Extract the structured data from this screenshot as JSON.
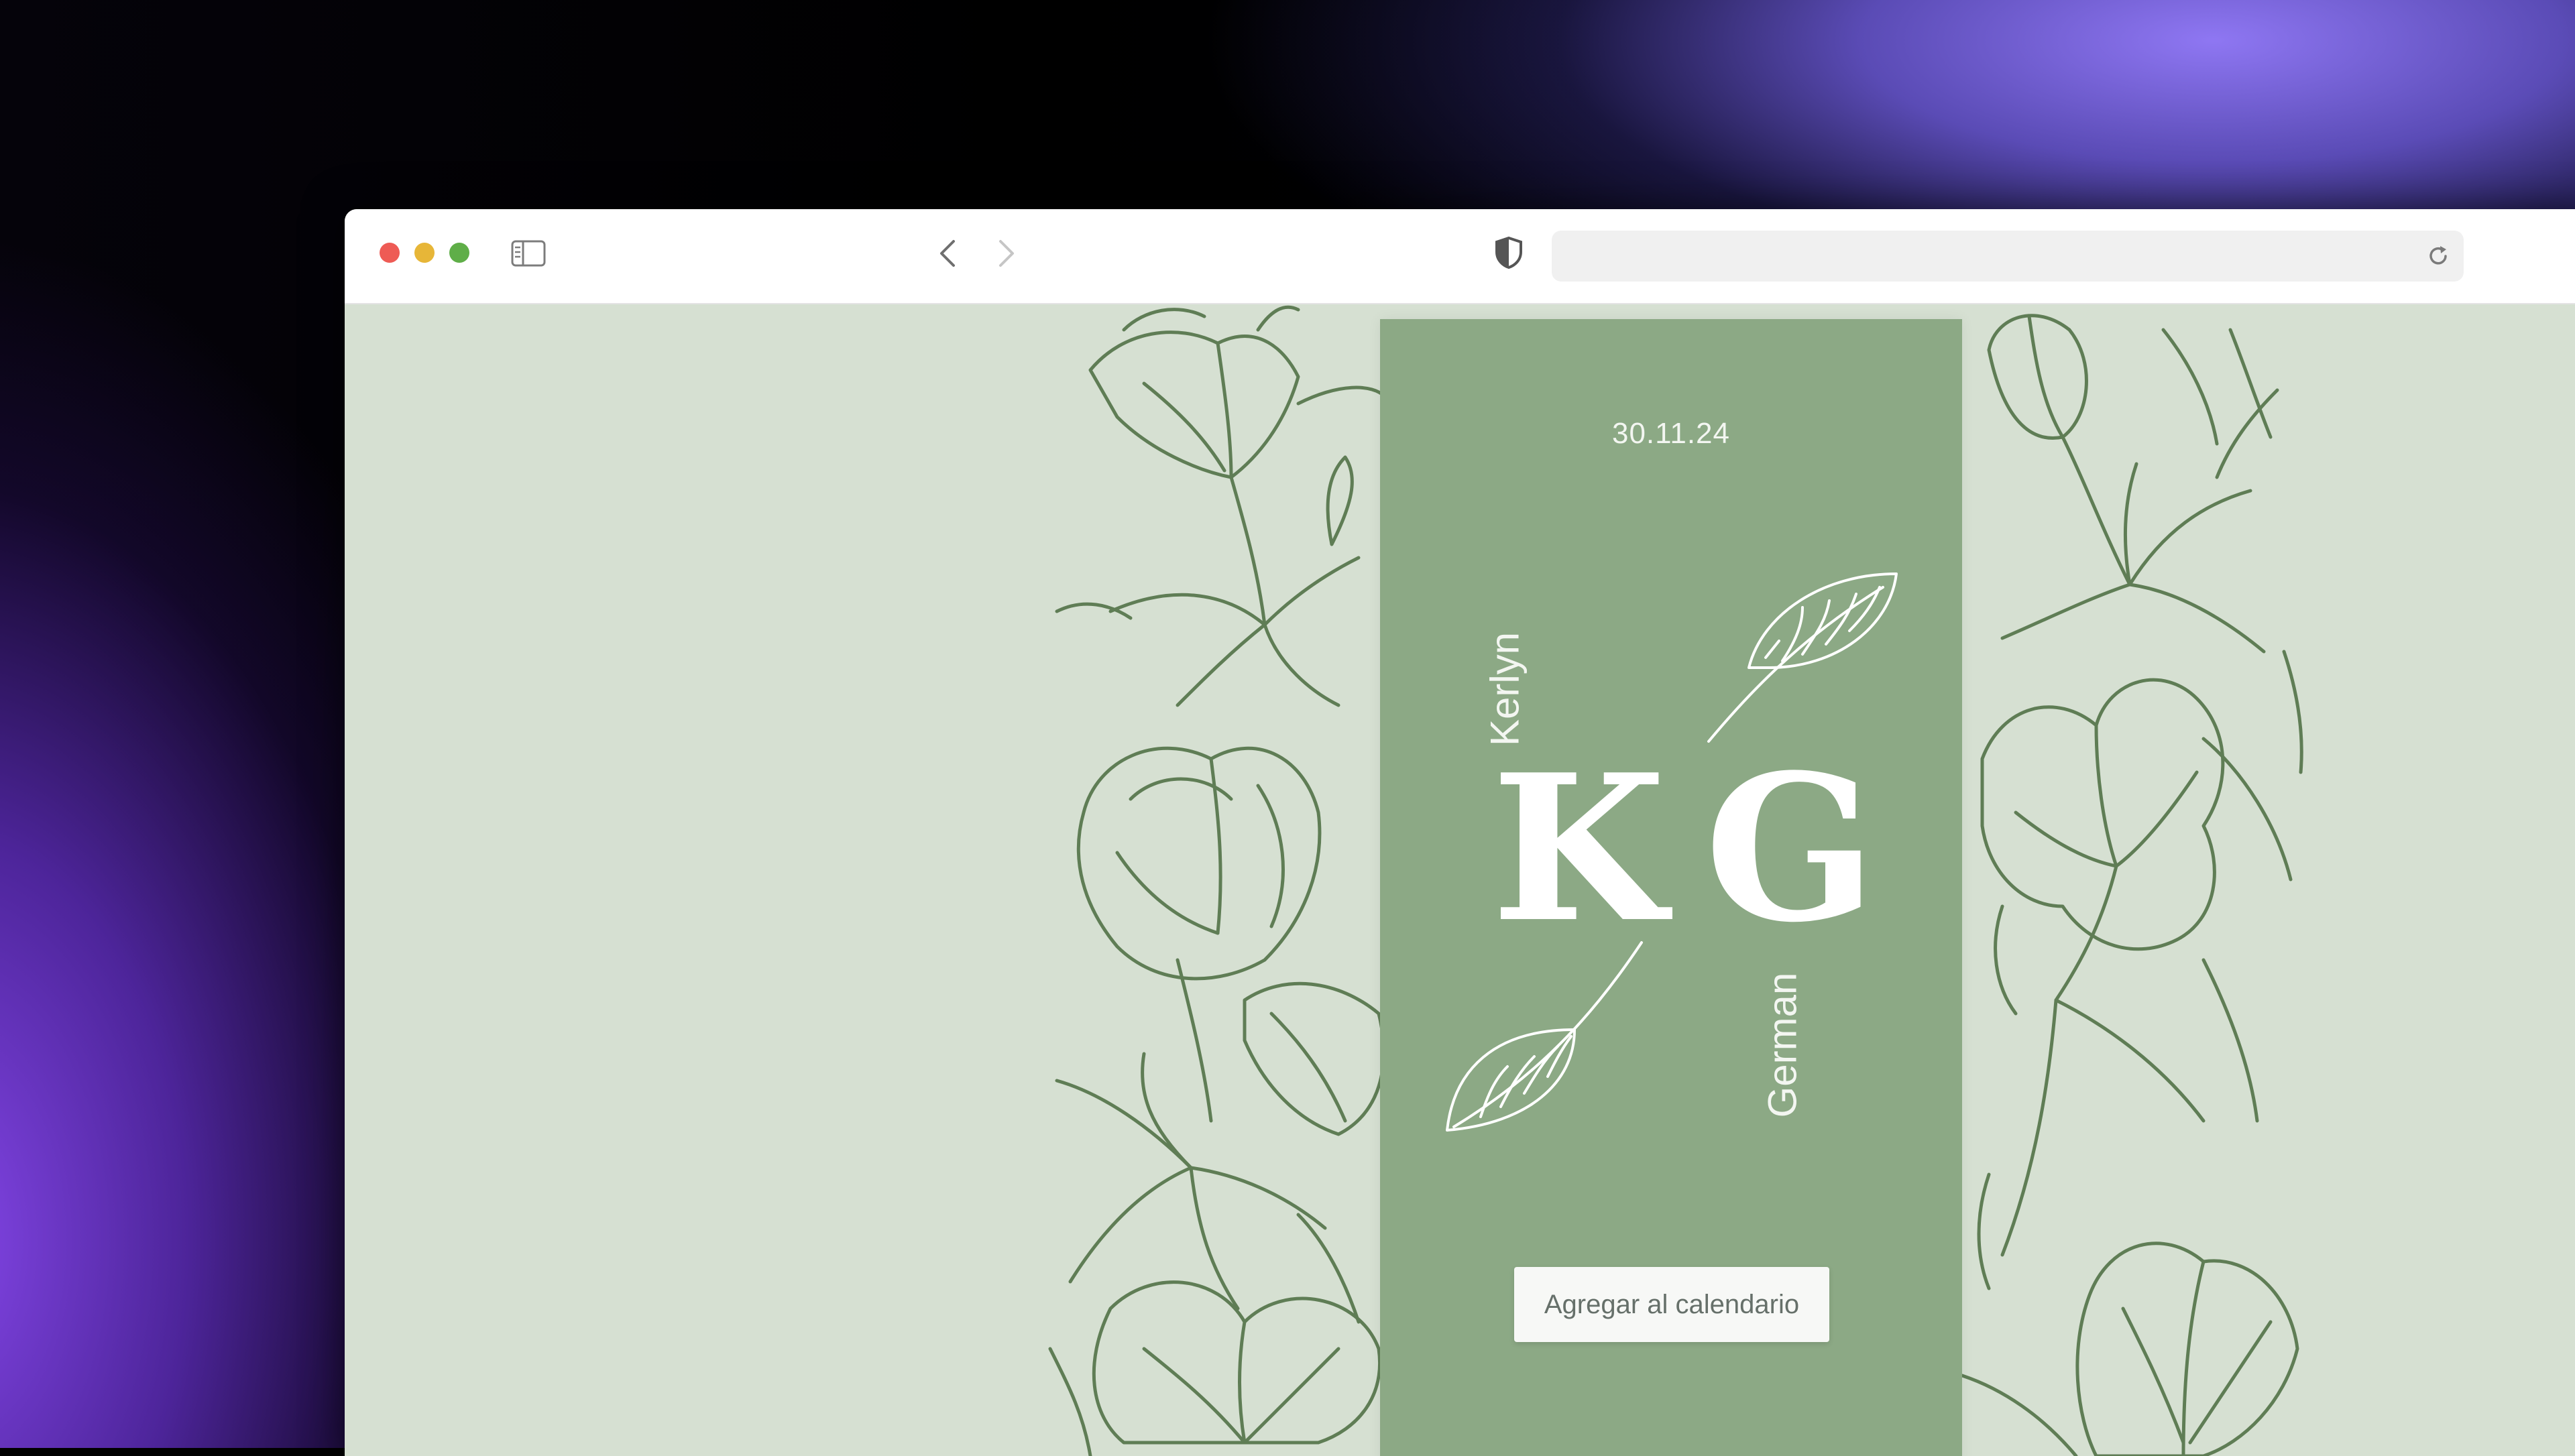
{
  "window": {
    "traffic_lights": [
      "close",
      "minimize",
      "zoom"
    ],
    "icons": {
      "sidebar": "sidebar-icon",
      "back": "chevron-left-icon",
      "forward": "chevron-right-icon",
      "privacy": "shield-icon",
      "reload": "reload-icon"
    },
    "address_bar": {
      "value": ""
    }
  },
  "invitation": {
    "date": "30.11.24",
    "name_left": "Kerlyn",
    "name_right": "German",
    "monogram_left": "K",
    "monogram_right": "G",
    "calendar_button_label": "Agregar al calendario"
  },
  "colors": {
    "page_background": "#d6e0d2",
    "card_background": "#8ca985",
    "floral_ink": "#5f7d55",
    "card_text": "#f3f6f1"
  }
}
